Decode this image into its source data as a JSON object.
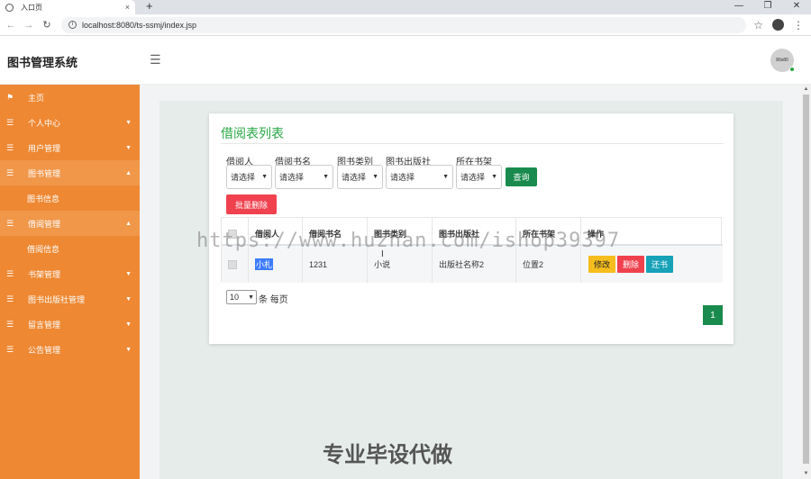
{
  "browser": {
    "tab_title": "入口页",
    "tab_close": "×",
    "new_tab": "+",
    "win_min": "—",
    "win_restore": "❐",
    "win_close": "✕",
    "url": "localhost:8080/ts-ssmj/index.jsp"
  },
  "header": {
    "brand": "图书管理系统",
    "avatar_text": "80x80"
  },
  "sidebar": {
    "items": [
      {
        "label": "主页",
        "icon": "flag-icon"
      },
      {
        "label": "个人中心",
        "icon": "list-icon"
      },
      {
        "label": "用户管理",
        "icon": "list-icon"
      },
      {
        "label": "图书管理",
        "icon": "list-icon"
      },
      {
        "label": "图书信息"
      },
      {
        "label": "借阅管理",
        "icon": "list-icon"
      },
      {
        "label": "借阅信息"
      },
      {
        "label": "书架管理",
        "icon": "list-icon"
      },
      {
        "label": "图书出版社管理",
        "icon": "list-icon"
      },
      {
        "label": "留言管理",
        "icon": "list-icon"
      },
      {
        "label": "公告管理",
        "icon": "list-icon"
      }
    ]
  },
  "card": {
    "title": "借阅表列表"
  },
  "filters": {
    "labels": [
      "借阅人",
      "借阅书名",
      "图书类别",
      "图书出版社",
      "所在书架"
    ],
    "placeholder": "请选择",
    "query_label": "查询",
    "batch_delete_label": "批量删除"
  },
  "table": {
    "headers": [
      "借阅人",
      "借阅书名",
      "图书类别",
      "图书出版社",
      "所在书架",
      "操作"
    ],
    "rows": [
      {
        "borrower": "小札",
        "book": "1231",
        "category": "小说",
        "publisher": "出版社名称2",
        "shelf": "位置2"
      }
    ],
    "actions": {
      "edit": "修改",
      "delete": "删除",
      "return": "还书"
    }
  },
  "pagination": {
    "page_size": "10",
    "page_size_label": "条 每页",
    "current_page": "1"
  },
  "overlay": {
    "watermark": "https://www.huzhan.com/ishop39397",
    "promo": "专业毕设代做"
  }
}
